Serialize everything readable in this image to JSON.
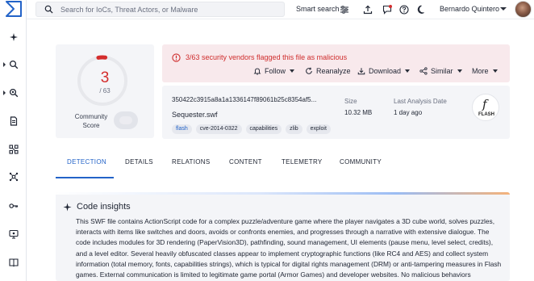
{
  "app": {
    "search_placeholder": "Search for IoCs, Threat Actors, or Malware",
    "smart_search_label": "Smart search",
    "user_name": "Bernardo Quintero"
  },
  "sidebar": {
    "items": [
      {
        "icon": "sparkle-icon",
        "has_caret": false
      },
      {
        "icon": "search-magnifier-icon",
        "has_caret": true
      },
      {
        "icon": "hunting-icon",
        "has_caret": true
      },
      {
        "icon": "document-icon",
        "has_caret": false
      },
      {
        "icon": "graph-icon",
        "has_caret": false
      },
      {
        "icon": "threat-network-icon",
        "has_caret": false
      },
      {
        "icon": "key-icon",
        "has_caret": false
      },
      {
        "icon": "monitor-icon",
        "has_caret": false
      },
      {
        "icon": "book-icon",
        "has_caret": false
      }
    ]
  },
  "score": {
    "detections": "3",
    "total": "/ 63",
    "community_label": "Community Score",
    "detection_ratio": 0.0476,
    "accent_color": "#d42d2d"
  },
  "alert": {
    "text": "3/63 security vendors flagged this file as malicious",
    "color": "#cf2c2c",
    "actions": {
      "follow": "Follow",
      "reanalyze": "Reanalyze",
      "download": "Download",
      "similar": "Similar",
      "more": "More"
    }
  },
  "file": {
    "hash": "350422c3915a8a1a1336147f89061b25c8354af5...",
    "name": "Sequester.swf",
    "tags": [
      "flash",
      "cve-2014-0322",
      "capabilities",
      "zlib",
      "exploit"
    ],
    "size_label": "Size",
    "size_value": "10.32 MB",
    "last_analysis_label": "Last Analysis Date",
    "last_analysis_value": "1 day ago",
    "type_icon_letter": "f",
    "type_icon_label": "FLASH"
  },
  "tabs": [
    "DETECTION",
    "DETAILS",
    "RELATIONS",
    "CONTENT",
    "TELEMETRY",
    "COMMUNITY"
  ],
  "insights": {
    "title": "Code insights",
    "body": "This SWF file contains ActionScript code for a complex puzzle/adventure game where the player navigates a 3D cube world, solves puzzles, interacts with items like switches and doors, avoids or confronts enemies, and progresses through a narrative with extensive dialogue. The code includes modules for 3D rendering (PaperVision3D), pathfinding, sound management, UI elements (pause menu, level select, credits), and a level editor. Several heavily obfuscated classes appear to implement cryptographic functions (like RC4 and AES) and collect system information (total memory, fonts, capabilities strings), which is typical for digital rights management (DRM) or anti-tampering measures in Flash games. External communication is limited to legitimate game portal (Armor Games) and developer websites. No malicious behaviors"
  },
  "colors": {
    "accent_blue": "#2363c8",
    "alert_bg": "#f8e9ec",
    "card_bg": "#f4f5f8"
  }
}
